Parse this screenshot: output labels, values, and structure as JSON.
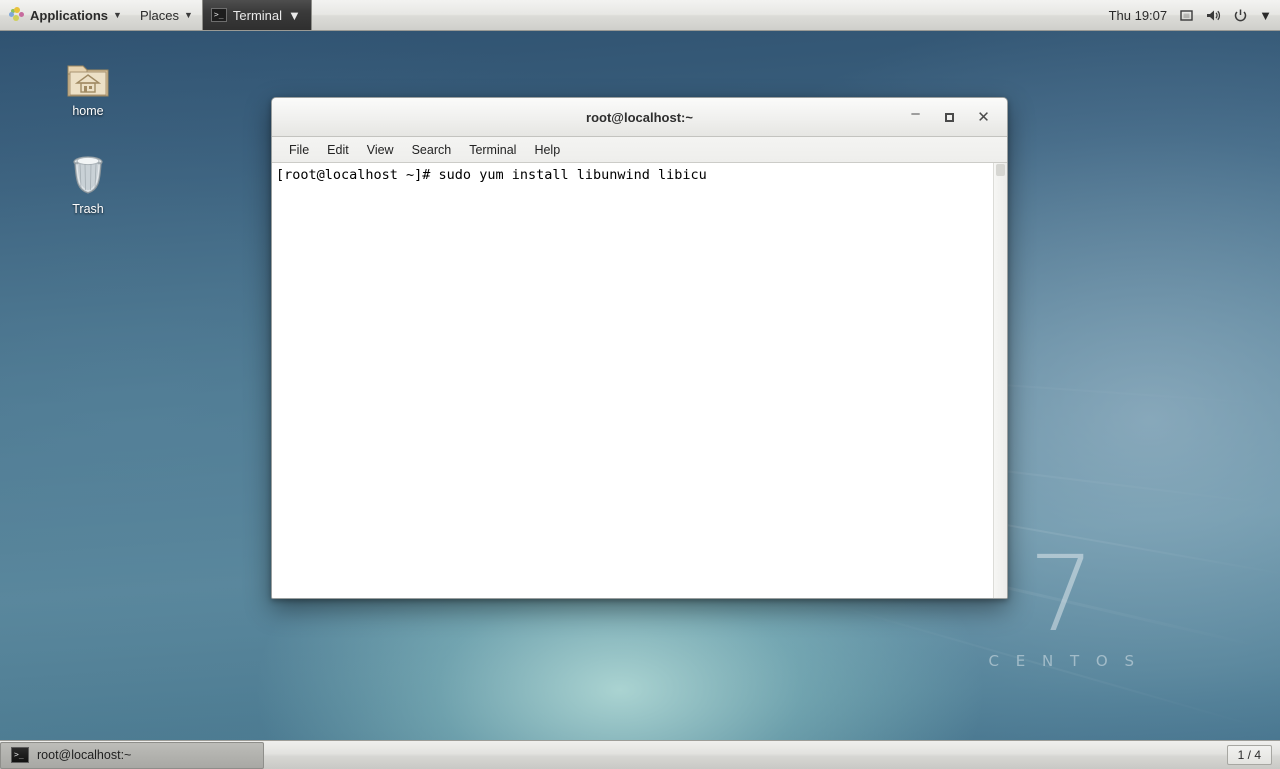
{
  "top_panel": {
    "applications_label": "Applications",
    "places_label": "Places",
    "window_entry_label": "Terminal",
    "clock": "Thu 19:07",
    "icons": {
      "apps_icon": "centos-starburst-icon",
      "terminal_icon": "terminal-icon",
      "network_icon": "network-icon",
      "volume_icon": "volume-icon",
      "power_icon": "power-icon",
      "caret": "▼"
    }
  },
  "desktop": {
    "icons": [
      {
        "name": "home",
        "label": "home"
      },
      {
        "name": "trash",
        "label": "Trash"
      }
    ],
    "watermark": {
      "version": "7",
      "brand": "C E N T O S"
    }
  },
  "terminal_window": {
    "title": "root@localhost:~",
    "controls": {
      "minimize": "–",
      "maximize": "□",
      "close": "✕"
    },
    "menus": [
      "File",
      "Edit",
      "View",
      "Search",
      "Terminal",
      "Help"
    ],
    "content": "[root@localhost ~]# sudo yum install libunwind libicu"
  },
  "bottom_panel": {
    "task_button_label": "root@localhost:~",
    "workspace_indicator": "1 / 4"
  },
  "colors": {
    "panel_bg": "#e7e7e4",
    "terminal_bg": "#ffffff",
    "terminal_fg": "#000000",
    "wallpaper_top": "#2d4f6e",
    "wallpaper_glow": "#b6ded9",
    "active_window_entry": "#3a3a3a"
  }
}
